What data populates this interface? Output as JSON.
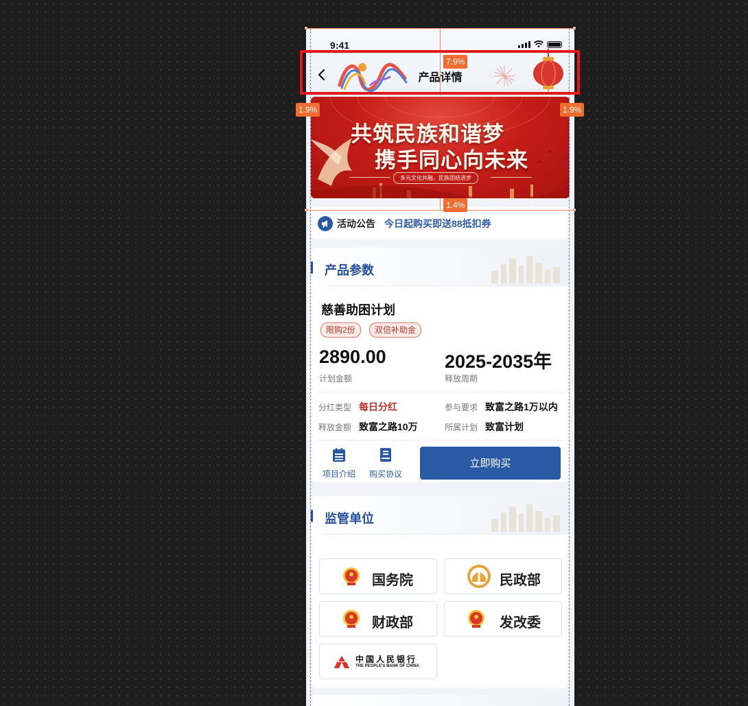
{
  "status_bar": {
    "time": "9:41"
  },
  "nav": {
    "title": "产品详情",
    "back_icon": "chevron-left-icon"
  },
  "banner": {
    "line1": "共筑民族和谐梦",
    "line2": "携手同心向未来",
    "subtitle": "多元文化共融，民族团结进步"
  },
  "notice": {
    "label": "活动公告",
    "text": "今日起购买即送88抵扣券",
    "icon": "megaphone-icon"
  },
  "product_section": {
    "title": "产品参数",
    "name": "慈善助困计划",
    "tags": [
      "限购2份",
      "双倍补助金"
    ],
    "amount": {
      "value": "2890.00",
      "label": "计划金额"
    },
    "period": {
      "value": "2025-2035年",
      "label": "释放周期"
    },
    "details": [
      {
        "key": "分红类型",
        "value": "每日分红"
      },
      {
        "key": "参与要求",
        "value": "致富之路1万以内"
      },
      {
        "key": "释放金额",
        "value": "致富之路10万"
      },
      {
        "key": "所属计划",
        "value": "致富计划"
      }
    ],
    "actions": [
      {
        "label": "项目介绍",
        "icon": "calendar-icon"
      },
      {
        "label": "购买协议",
        "icon": "document-icon"
      }
    ],
    "buy_label": "立即购买"
  },
  "regulator_section": {
    "title": "监管单位",
    "units": [
      {
        "name": "国务院",
        "icon": "national-emblem-icon"
      },
      {
        "name": "民政部",
        "icon": "civil-affairs-emblem-icon"
      },
      {
        "name": "财政部",
        "icon": "national-emblem-icon"
      },
      {
        "name": "发改委",
        "icon": "national-emblem-icon"
      }
    ],
    "pboc": {
      "cn": "中国人民银行",
      "en": "THE PEOPLE'S BANK OF CHINA",
      "icon": "pboc-logo-icon"
    }
  },
  "overlay": {
    "top_margin": "7.9%",
    "left_margin": "1.9%",
    "right_margin": "1.9%",
    "banner_gap": "1.4%"
  },
  "colors": {
    "primary": "#2a5aa3",
    "title_blue": "#254f9c",
    "accent_red": "#c0302a",
    "banner_red": "#c61d19",
    "selection": "#e01a1a",
    "overlay_orange": "#f06d2f"
  }
}
